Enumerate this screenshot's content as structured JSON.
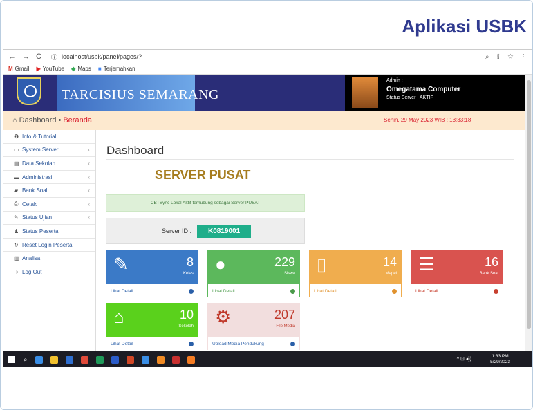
{
  "slide_title": "Aplikasi USBK",
  "browser": {
    "url": "localhost/usbk/panel/pages/?",
    "bookmarks": [
      "Gmail",
      "YouTube",
      "Maps",
      "Terjemahkan"
    ]
  },
  "header": {
    "school_name": "TARCISIUS SEMARANG",
    "admin_label": "Admin :",
    "admin_name": "Omegatama Computer",
    "server_status": "Status Server : AKTIF"
  },
  "breadcrumb": {
    "home": "Dashboard",
    "sep": "•",
    "current": "Beranda",
    "datetime": "Senin,  29 May 2023   WIB :  13:33:18"
  },
  "sidebar": {
    "items": [
      {
        "label": "Info & Tutorial",
        "icon": "info-icon",
        "glyph": "❶",
        "chev": ""
      },
      {
        "label": "System Server",
        "icon": "monitor-icon",
        "glyph": "▭",
        "chev": "‹"
      },
      {
        "label": "Data Sekolah",
        "icon": "building-icon",
        "glyph": "▤",
        "chev": "‹"
      },
      {
        "label": "Administrasi",
        "icon": "card-icon",
        "glyph": "▬",
        "chev": "‹"
      },
      {
        "label": "Bank Soal",
        "icon": "book-icon",
        "glyph": "▰",
        "chev": "‹"
      },
      {
        "label": "Cetak",
        "icon": "print-icon",
        "glyph": "⎙",
        "chev": "‹"
      },
      {
        "label": "Status Ujian",
        "icon": "edit-icon",
        "glyph": "✎",
        "chev": "‹"
      },
      {
        "label": "Status Peserta",
        "icon": "user-icon",
        "glyph": "♟",
        "chev": ""
      },
      {
        "label": "Reset Login Peserta",
        "icon": "refresh-icon",
        "glyph": "↻",
        "chev": ""
      },
      {
        "label": "Analisa",
        "icon": "chart-icon",
        "glyph": "▥",
        "chev": ""
      },
      {
        "label": "Log Out",
        "icon": "logout-icon",
        "glyph": "➜",
        "chev": ""
      }
    ]
  },
  "main": {
    "heading": "Dashboard",
    "server_title": "SERVER PUSAT",
    "alert": "CBTSync Lokal Aktif terhubung sebagai Server PUSAT",
    "server_id_label": "Server ID :",
    "server_id": "K0819001",
    "cards": [
      {
        "value": "8",
        "label": "Kelas",
        "link": "Lihat Detail",
        "icon": "edit-icon",
        "glyph": "✎",
        "color": "#3b7ac7",
        "text": "#2a5fa8"
      },
      {
        "value": "229",
        "label": "Siswa",
        "link": "Lihat Detail",
        "icon": "user-icon",
        "glyph": "●",
        "color": "#5cb85c",
        "text": "#4a9a4a"
      },
      {
        "value": "14",
        "label": "Mapel",
        "link": "Lihat Detail",
        "icon": "book-icon",
        "glyph": "▯",
        "color": "#f0ad4e",
        "text": "#e0922e"
      },
      {
        "value": "16",
        "label": "Bank Soal",
        "link": "Lihat Detail",
        "icon": "server-icon",
        "glyph": "☰",
        "color": "#d9534f",
        "text": "#c7402f"
      },
      {
        "value": "10",
        "label": "Sekolah",
        "link": "Lihat Detail",
        "icon": "home-icon",
        "glyph": "⌂",
        "color": "#5ad11c",
        "text": "#2a5fa8"
      },
      {
        "value": "207",
        "label": "File Media",
        "link": "Upload Media Pendukung",
        "icon": "gears-icon",
        "glyph": "⚙",
        "color": "#f2dede",
        "text": "#2a5fa8"
      }
    ]
  },
  "taskbar": {
    "time": "1:33 PM",
    "date": "5/29/2023"
  }
}
